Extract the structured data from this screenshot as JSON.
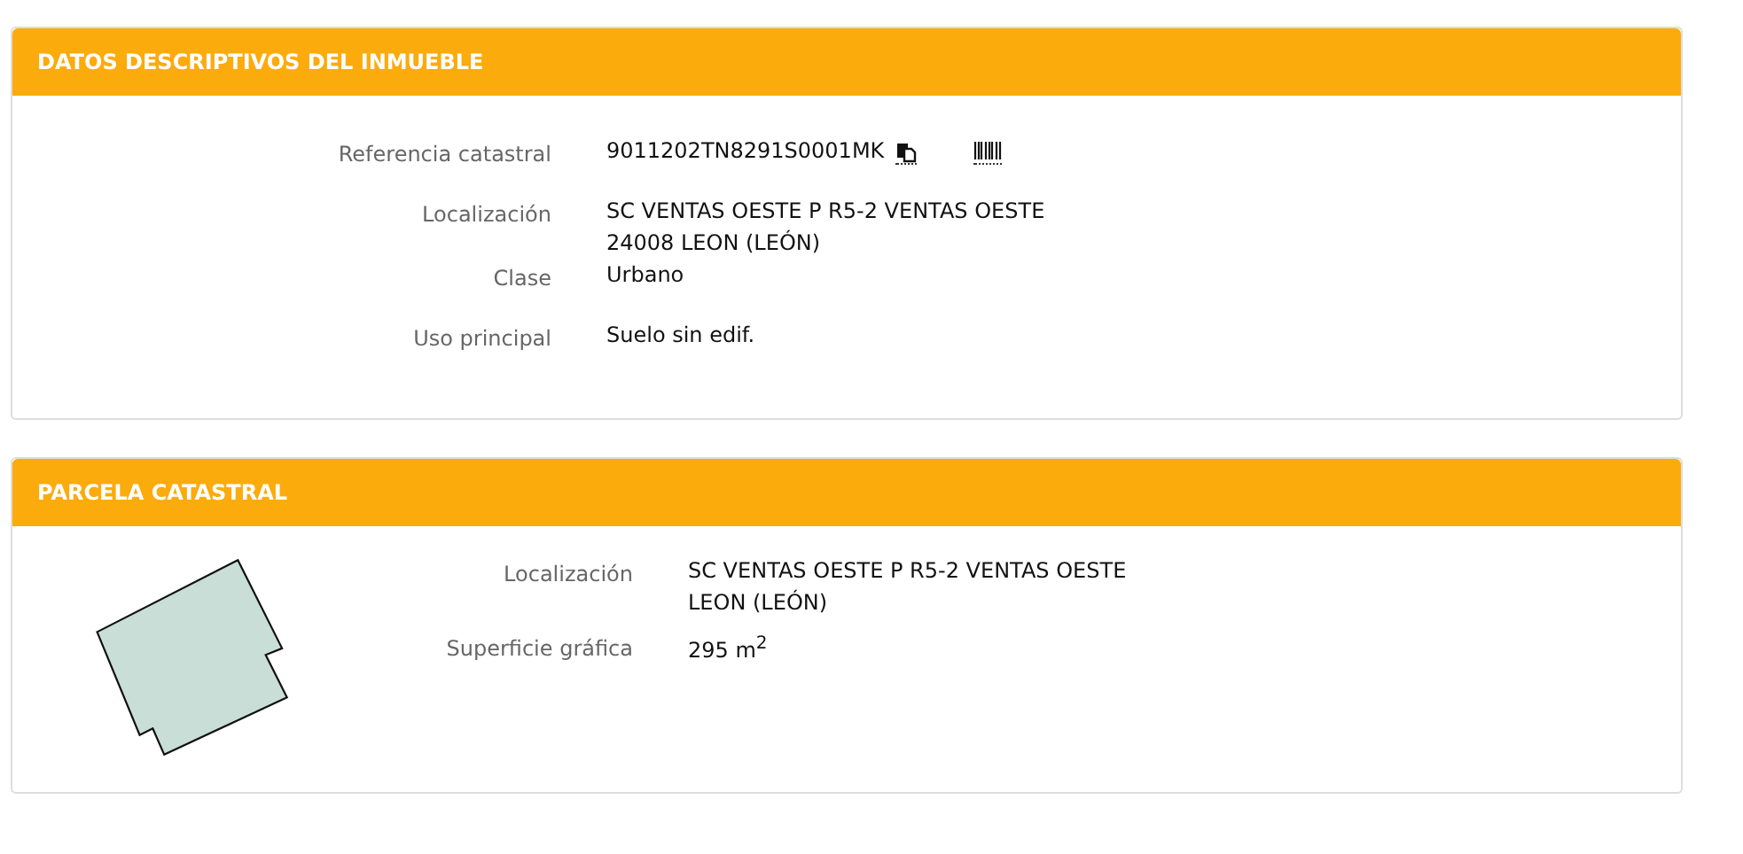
{
  "panels": [
    {
      "title": "DATOS DESCRIPTIVOS DEL INMUEBLE",
      "kind": "details",
      "fields": [
        {
          "label": "Referencia catastral",
          "lines": [
            "9011202TN8291S0001MK"
          ],
          "kind": "reference"
        },
        {
          "label": "Localización",
          "lines": [
            "SC VENTAS OESTE P R5-2 VENTAS OESTE",
            "24008 LEON (LEÓN)"
          ],
          "kind": "text"
        },
        {
          "label": "Clase",
          "lines": [
            "Urbano"
          ],
          "kind": "text"
        },
        {
          "label": "Uso principal",
          "lines": [
            "Suelo sin edif."
          ],
          "kind": "text"
        }
      ]
    },
    {
      "title": "PARCELA CATASTRAL",
      "kind": "parcel",
      "fields": [
        {
          "label": "Localización",
          "lines": [
            "SC VENTAS OESTE P R5-2 VENTAS OESTE",
            "LEON (LEÓN)"
          ],
          "kind": "text"
        },
        {
          "label": "Superficie gráfica",
          "lines": [
            "295 m$^{2}$"
          ],
          "kind": "text"
        }
      ]
    }
  ]
}
